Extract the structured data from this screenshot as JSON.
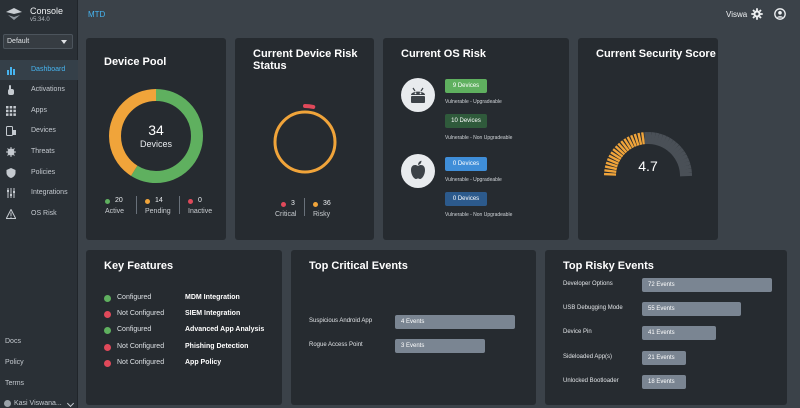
{
  "app": {
    "name": "Console",
    "version": "v5.34.0",
    "page_title": "MTD"
  },
  "tenant": {
    "selected": "Default"
  },
  "sidebar": {
    "items": [
      {
        "label": "Dashboard",
        "icon": "bar-chart-icon",
        "active": true
      },
      {
        "label": "Activations",
        "icon": "hand-pointer-icon",
        "active": false
      },
      {
        "label": "Apps",
        "icon": "grid-icon",
        "active": false
      },
      {
        "label": "Devices",
        "icon": "devices-icon",
        "active": false
      },
      {
        "label": "Threats",
        "icon": "bug-icon",
        "active": false
      },
      {
        "label": "Policies",
        "icon": "shield-icon",
        "active": false
      },
      {
        "label": "Integrations",
        "icon": "sliders-icon",
        "active": false
      },
      {
        "label": "OS Risk",
        "icon": "warning-icon",
        "active": false
      }
    ],
    "footer": {
      "docs": "Docs",
      "policy": "Policy",
      "terms": "Terms",
      "user": "Kasi Viswana..."
    }
  },
  "topbar": {
    "user": "Viswa"
  },
  "device_pool": {
    "title": "Device Pool",
    "total": "34",
    "total_label": "Devices",
    "legend": [
      {
        "value": "20",
        "label": "Active",
        "color": "#5fb05f"
      },
      {
        "value": "14",
        "label": "Pending",
        "color": "#f0a43a"
      },
      {
        "value": "0",
        "label": "Inactive",
        "color": "#e0495a"
      }
    ]
  },
  "risk_status": {
    "title_line1": "Current Device Risk",
    "title_line2": "Status",
    "critical": {
      "value": "3",
      "label": "Critical",
      "color": "#e0495a"
    },
    "risky": {
      "value": "36",
      "label": "Risky",
      "color": "#f0a43a"
    }
  },
  "os_risk": {
    "title": "Current OS Risk",
    "android": {
      "upgradeable": {
        "count": "9 Devices",
        "note": "Vulnerable - Upgradeable",
        "color": "#5fb05f"
      },
      "non_upgradeable": {
        "count": "10 Devices",
        "note": "Vulnerable - Non Upgradeable",
        "color": "#2f5a3b"
      }
    },
    "ios": {
      "upgradeable": {
        "count": "0 Devices",
        "note": "Vulnerable - Upgradeable",
        "color": "#3f8ed8"
      },
      "non_upgradeable": {
        "count": "0 Devices",
        "note": "Vulnerable - Non Upgradeable",
        "color": "#2c5a8c"
      }
    }
  },
  "security_score": {
    "title": "Current Security Score",
    "score": "4.7",
    "score_value": 4.7,
    "max": 10,
    "fill_color": "#f0a43a"
  },
  "key_features": {
    "title": "Key Features",
    "rows": [
      {
        "status": "Configured",
        "feature": "MDM Integration",
        "color": "#5fb05f"
      },
      {
        "status": "Not Configured",
        "feature": "SIEM Integration",
        "color": "#e0495a"
      },
      {
        "status": "Configured",
        "feature": "Advanced App Analysis",
        "color": "#5fb05f"
      },
      {
        "status": "Not Configured",
        "feature": "Phishing Detection",
        "color": "#e0495a"
      },
      {
        "status": "Not Configured",
        "feature": "App Policy",
        "color": "#e0495a"
      }
    ]
  },
  "critical_events": {
    "title": "Top Critical Events",
    "rows": [
      {
        "label": "Suspicious Android App",
        "text": "4 Events",
        "count": 4
      },
      {
        "label": "Rogue Access Point",
        "text": "3 Events",
        "count": 3
      }
    ]
  },
  "risky_events": {
    "title": "Top Risky Events",
    "rows": [
      {
        "label": "Developer Options",
        "text": "72 Events",
        "count": 72
      },
      {
        "label": "USB Debugging Mode",
        "text": "55 Events",
        "count": 55
      },
      {
        "label": "Device Pin",
        "text": "41 Events",
        "count": 41
      },
      {
        "label": "Sideloaded App(s)",
        "text": "21 Events",
        "count": 21
      },
      {
        "label": "Unlocked Bootloader",
        "text": "18 Events",
        "count": 18
      }
    ]
  }
}
